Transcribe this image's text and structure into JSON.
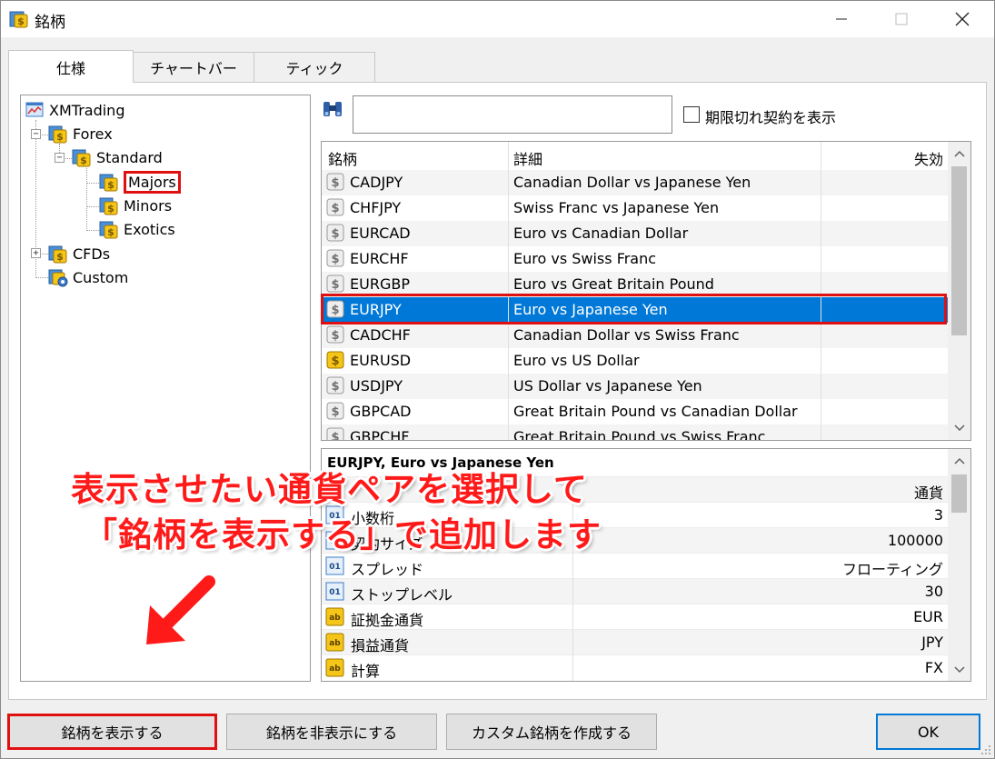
{
  "window": {
    "title": "銘柄",
    "minimize_icon": "minimize-icon",
    "maximize_icon": "maximize-icon",
    "close_icon": "close-icon"
  },
  "tabs": [
    {
      "label": "仕様",
      "active": true
    },
    {
      "label": "チャートバー",
      "active": false
    },
    {
      "label": "ティック",
      "active": false
    }
  ],
  "tree": {
    "root": "XMTrading",
    "forex": "Forex",
    "standard": "Standard",
    "majors": "Majors",
    "minors": "Minors",
    "exotics": "Exotics",
    "cfds": "CFDs",
    "custom": "Custom",
    "expand_symbol": "+",
    "collapse_symbol": "−"
  },
  "search": {
    "value": "",
    "placeholder": ""
  },
  "expired_checkbox": {
    "label": "期限切れ契約を表示",
    "checked": false
  },
  "symbols": {
    "columns": [
      "銘柄",
      "詳細",
      "失効"
    ],
    "rows": [
      {
        "symbol": "CADJPY",
        "desc": "Canadian Dollar vs Japanese Yen",
        "expiry": "",
        "icon": "gray",
        "selected": false
      },
      {
        "symbol": "CHFJPY",
        "desc": "Swiss Franc vs Japanese Yen",
        "expiry": "",
        "icon": "gray",
        "selected": false
      },
      {
        "symbol": "EURCAD",
        "desc": "Euro vs Canadian Dollar",
        "expiry": "",
        "icon": "gray",
        "selected": false
      },
      {
        "symbol": "EURCHF",
        "desc": "Euro vs Swiss Franc",
        "expiry": "",
        "icon": "gray",
        "selected": false
      },
      {
        "symbol": "EURGBP",
        "desc": "Euro vs Great Britain Pound",
        "expiry": "",
        "icon": "gray",
        "selected": false
      },
      {
        "symbol": "EURJPY",
        "desc": "Euro vs Japanese Yen",
        "expiry": "",
        "icon": "gray",
        "selected": true
      },
      {
        "symbol": "CADCHF",
        "desc": "Canadian Dollar vs Swiss Franc",
        "expiry": "",
        "icon": "gray",
        "selected": false
      },
      {
        "symbol": "EURUSD",
        "desc": "Euro vs US Dollar",
        "expiry": "",
        "icon": "gold",
        "selected": false
      },
      {
        "symbol": "USDJPY",
        "desc": "US Dollar vs Japanese Yen",
        "expiry": "",
        "icon": "gray",
        "selected": false
      },
      {
        "symbol": "GBPCAD",
        "desc": "Great Britain Pound vs Canadian Dollar",
        "expiry": "",
        "icon": "gray",
        "selected": false
      },
      {
        "symbol": "GBPCHF",
        "desc": "Great Britain Pound vs Swiss Franc",
        "expiry": "",
        "icon": "gray",
        "selected": false
      }
    ]
  },
  "properties": {
    "title": "EURJPY, Euro vs Japanese Yen",
    "rows": [
      {
        "key": "",
        "value": "通貨",
        "icon": "none"
      },
      {
        "key": "小数桁",
        "value": "3",
        "icon": "num"
      },
      {
        "key": "契約サイズ",
        "value": "100000",
        "icon": "num"
      },
      {
        "key": "スプレッド",
        "value": "フローティング",
        "icon": "num"
      },
      {
        "key": "ストップレベル",
        "value": "30",
        "icon": "num"
      },
      {
        "key": "証拠金通貨",
        "value": "EUR",
        "icon": "ab"
      },
      {
        "key": "損益通貨",
        "value": "JPY",
        "icon": "ab"
      },
      {
        "key": "計算",
        "value": "FX",
        "icon": "ab"
      }
    ]
  },
  "annotation": {
    "line1": "表示させたい通貨ペアを選択して",
    "line2": "「銘柄を表示する」で追加します",
    "color": "#ff1a1a"
  },
  "buttons": {
    "show": "銘柄を表示する",
    "hide": "銘柄を非表示にする",
    "create_custom": "カスタム銘柄を作成する",
    "ok": "OK"
  },
  "colors": {
    "selection": "#0078d7",
    "highlight_frame": "#e01010"
  }
}
